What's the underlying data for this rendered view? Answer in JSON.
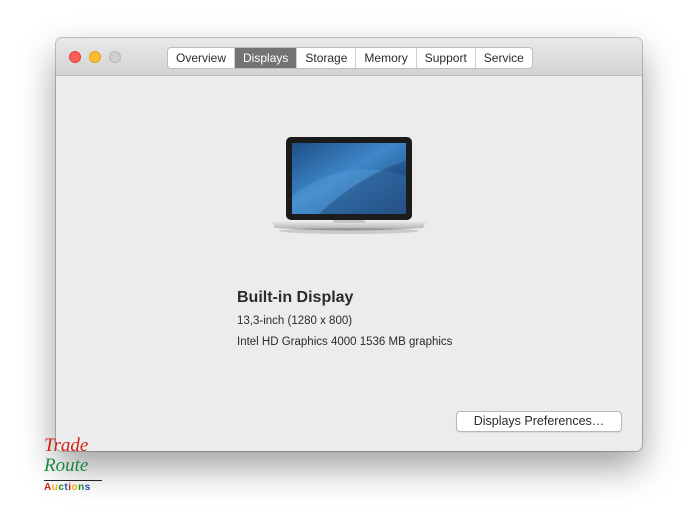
{
  "window": {
    "tabs": [
      {
        "label": "Overview",
        "active": false
      },
      {
        "label": "Displays",
        "active": true
      },
      {
        "label": "Storage",
        "active": false
      },
      {
        "label": "Memory",
        "active": false
      },
      {
        "label": "Support",
        "active": false
      },
      {
        "label": "Service",
        "active": false
      }
    ]
  },
  "display": {
    "title": "Built-in Display",
    "size_resolution": "13,3-inch (1280 x 800)",
    "graphics": "Intel HD Graphics 4000 1536 MB graphics",
    "preferences_button": "Displays Preferences…"
  },
  "watermark": {
    "line1": "Trade",
    "line2": "Route",
    "line3": "Auctions",
    "line3_colors": [
      "#d0201a",
      "#e8b400",
      "#178a3d",
      "#1a4fb0",
      "#d0201a",
      "#e8b400",
      "#178a3d",
      "#1a4fb0"
    ]
  },
  "icons": {
    "close": "close-icon",
    "minimize": "minimize-icon",
    "zoom": "zoom-icon",
    "laptop": "laptop-icon"
  },
  "colors": {
    "window_bg": "#ececec",
    "active_tab": "#737373",
    "close": "#fd5f57",
    "minimize": "#febc2e",
    "zoom_inactive": "#cfcfcf"
  }
}
